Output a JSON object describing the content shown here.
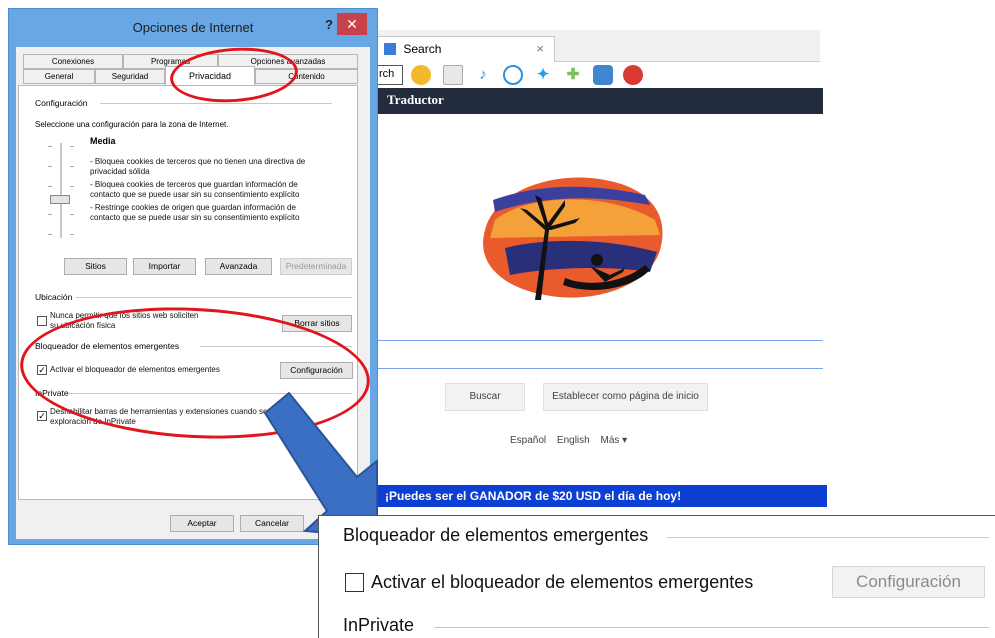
{
  "browser": {
    "tab_title": "Search",
    "tab_close": "×",
    "toolbar_search_fragment": "rch",
    "nav_item": "Traductor",
    "buttons": {
      "search": "Buscar",
      "set_home": "Establecer como página de inicio"
    },
    "languages": [
      "Español",
      "English",
      "Más ▾"
    ],
    "banner": "¡Puedes ser el GANADOR de $20 USD el día de hoy!",
    "colors": {
      "navbar": "#232c3e",
      "banner": "#0e3fd3",
      "accent_line": "#7aa2ee"
    }
  },
  "dialog": {
    "title": "Opciones de Internet",
    "help": "?",
    "close": "✕",
    "tabs_back": [
      "Conexiones",
      "Programas",
      "Opciones avanzadas"
    ],
    "tabs_front": [
      "General",
      "Seguridad",
      "Privacidad",
      "Contenido"
    ],
    "active_tab": "Privacidad",
    "config": {
      "heading": "Configuración",
      "instruction": "Seleccione una configuración para la zona de Internet.",
      "level": "Media",
      "description": [
        "- Bloquea cookies de terceros que no tienen una directiva de",
        "privacidad sólida",
        "- Bloquea cookies de terceros que guardan información de",
        "contacto que se puede usar sin su consentimiento explícito",
        "- Restringe cookies de origen que guardan información de",
        "contacto que se puede usar sin su consentimiento explícito"
      ],
      "slider_level": 0.45,
      "buttons": {
        "sites": "Sitios",
        "import": "Importar",
        "advanced": "Avanzada",
        "default": "Predeterminada"
      }
    },
    "location": {
      "heading": "Ubicación",
      "checkbox_line1": "Nunca permitir que los sitios web soliciten",
      "checkbox_line2": "su ubicación física",
      "button": "Borrar sitios"
    },
    "popup": {
      "heading": "Bloqueador de elementos emergentes",
      "checkbox_label": "Activar el bloqueador de elementos emergentes",
      "checked": true,
      "button": "Configuración"
    },
    "inprivate": {
      "heading": "InPrivate",
      "checkbox_line1": "Deshabilitar barras de herramientas y extensiones cuando se inicie la",
      "checkbox_line2": "exploración de InPrivate",
      "checked": true
    },
    "footer": {
      "ok": "Aceptar",
      "cancel": "Cancelar"
    },
    "colors": {
      "frame": "#68a7e3",
      "close": "#c7424a",
      "highlight_circle": "#e0161d"
    }
  },
  "zoom": {
    "popup_heading": "Bloqueador de elementos emergentes",
    "popup_checkbox_label": "Activar el bloqueador de elementos emergentes",
    "popup_checked": false,
    "popup_button": "Configuración",
    "inprivate_heading": "InPrivate"
  },
  "arrow_color": "#3b6fc4"
}
